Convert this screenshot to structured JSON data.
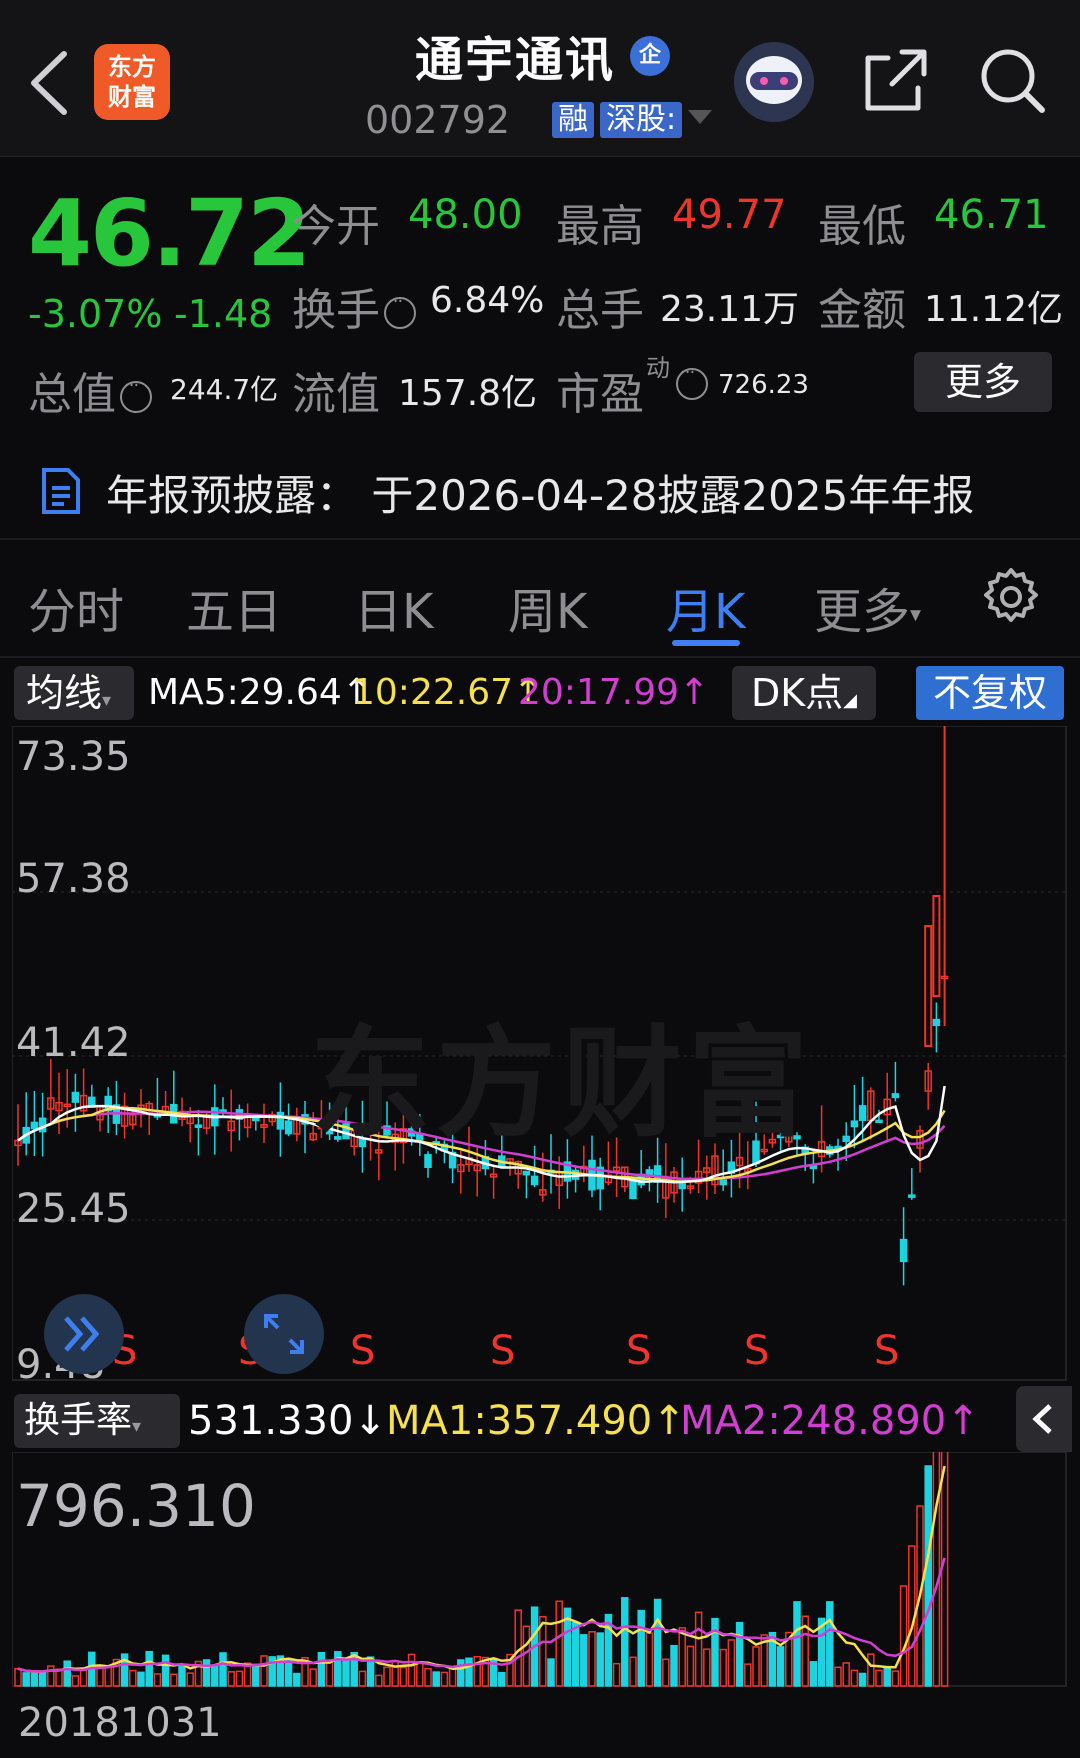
{
  "header": {
    "logo_line1": "东方",
    "logo_line2": "财富",
    "title": "通宇通讯",
    "title_badge": "企",
    "code": "002792",
    "tags": [
      "融",
      "深股:"
    ]
  },
  "quote": {
    "price": "46.72",
    "change_pct": "-3.07%",
    "change_abs": "-1.48",
    "open_label": "今开",
    "open": "48.00",
    "high_label": "最高",
    "high": "49.77",
    "low_label": "最低",
    "low": "46.71",
    "turnover_label": "换手",
    "turnover": "6.84%",
    "volume_label": "总手",
    "volume": "23.11万",
    "amount_label": "金额",
    "amount": "11.12亿",
    "mktcap_label": "总值",
    "mktcap": "244.7亿",
    "float_label": "流值",
    "float": "157.8亿",
    "pe_label": "市盈",
    "pe_sup": "动",
    "pe": "726.23",
    "more_label": "更多"
  },
  "notice": {
    "text": "年报预披露：  于2026-04-28披露2025年年报"
  },
  "tabs": {
    "items": [
      "分时",
      "五日",
      "日K",
      "周K",
      "月K",
      "更多"
    ],
    "active": "月K"
  },
  "ma_bar": {
    "chip": "均线",
    "ma5": "MA5:29.64↑",
    "ma10": "10:22.67↑",
    "ma20": "20:17.99↑",
    "dk": "DK点",
    "adjust": "不复权"
  },
  "kline_axis": [
    "73.35",
    "57.38",
    "41.42",
    "25.45",
    "9.48"
  ],
  "signal_label": "S",
  "watermark": "东方财富",
  "volume_bar": {
    "chip": "换手率",
    "value": "531.330↓",
    "ma1": "MA1:357.490↑",
    "ma2": "MA2:248.890↑",
    "axis_max": "796.310",
    "start_date": "20181031"
  },
  "colors": {
    "up": "#f0342c",
    "down": "#1ed3e0",
    "ma5": "#ffffff",
    "ma10": "#f5e050",
    "ma20": "#d23ed2",
    "accent": "#3d7ef0"
  }
}
